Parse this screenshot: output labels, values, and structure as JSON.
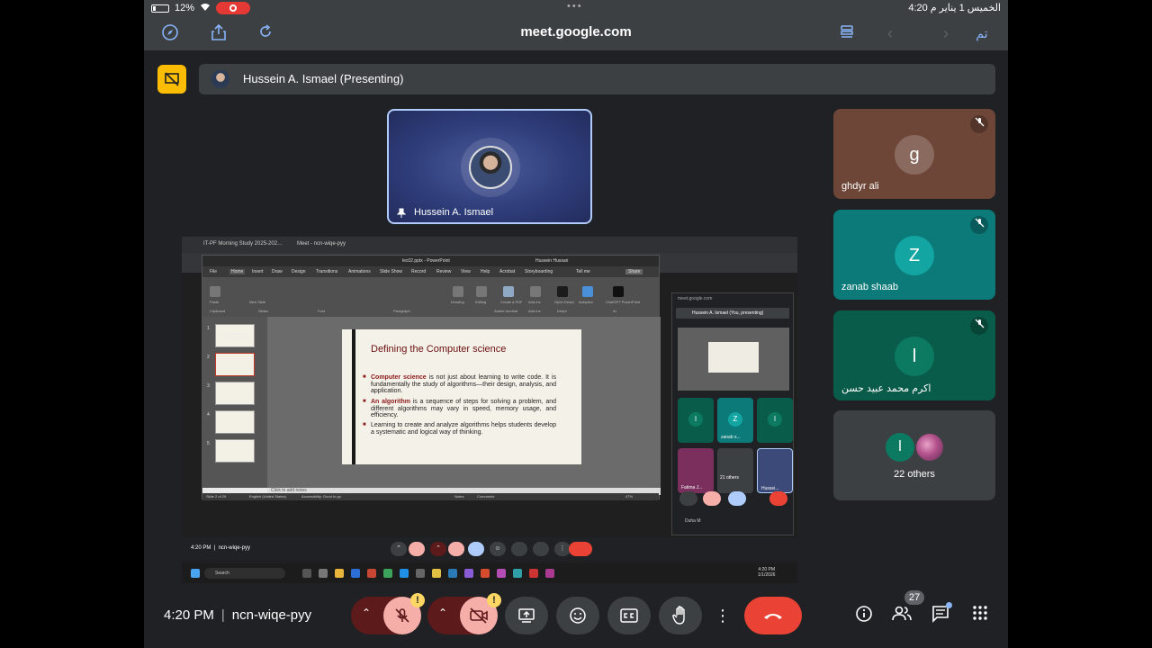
{
  "status_bar": {
    "battery": "12%",
    "dots": "•••",
    "datetime": "4:20  الخميس 1 يناير م"
  },
  "browser": {
    "url": "meet.google.com",
    "done_label": "تم"
  },
  "presentation": {
    "presenter_label": "Hussein A. Ismael (Presenting)",
    "presenter_tile_name": "Hussein A. Ismael"
  },
  "participants": [
    {
      "initial": "g",
      "name": "ghdyr ali"
    },
    {
      "initial": "Z",
      "name": "zanab shaab"
    },
    {
      "initial": "ا",
      "name": "اكرم محمد عبيد حسن"
    }
  ],
  "others": {
    "initial": "ا",
    "label": "22 others"
  },
  "shared_screen": {
    "tab1": "IT-PF Morning Study 2025-202…",
    "tab2": "Meet - ncn-wiqe-pyy",
    "ppt_title": "lec02.pptx  -  PowerPoint",
    "ppt_user": "Hussein Hussari",
    "ribbon_tabs": [
      "File",
      "Home",
      "Insert",
      "Draw",
      "Design",
      "Transitions",
      "Animations",
      "Slide Show",
      "Record",
      "Review",
      "View",
      "Help",
      "Acrobat",
      "Storyboarding",
      "Tell me"
    ],
    "ribbon_groups": [
      "Clipboard",
      "Slides",
      "Font",
      "Paragraph",
      "Adobe Acrobat",
      "Add-ins",
      "Deepl",
      "AI"
    ],
    "ribbon_buttons": [
      "Paste",
      "New Slide",
      "Drawing",
      "Editing",
      "Create a PDF",
      "Add-ins",
      "Open DeepL",
      "Autopilot",
      "ChatGPT PowerPoint"
    ],
    "share_button": "Share",
    "slide": {
      "title": "Defining the Computer science",
      "bullets": [
        {
          "key": "Computer science",
          "text": " is not just about learning to write code. It is fundamentally the study of algorithms—their design, analysis, and application."
        },
        {
          "key": "An algorithm",
          "text": " is a sequence of steps for solving a problem, and different algorithms may vary in speed, memory usage, and efficiency."
        },
        {
          "key": "",
          "text": "Learning to create and analyze algorithms helps students develop a systematic and logical way of thinking."
        }
      ]
    },
    "thumb_title": "PROGRAMMING FUNDAMENTALS I",
    "notes_placeholder": "Click to add notes",
    "status": {
      "slide": "Slide 2 of 29",
      "language": "English (United States)",
      "accessibility": "Accessibility: Good to go",
      "notes": "Notes",
      "comments": "Comments",
      "zoom": "47%"
    },
    "mini_meet": {
      "url": "meet.google.com",
      "header": "Hussein A. Ismael (You, presenting)",
      "tiles": [
        "ا",
        "zanab s...",
        "ا",
        "Fatima J...",
        "21 others",
        "Hussei..."
      ],
      "footer_name": "Duha M",
      "badge": "27"
    },
    "meet_bar": {
      "time": "4:20 PM",
      "code": "ncn-wiqe-pyy"
    },
    "taskbar": {
      "search": "Search",
      "time": "4:20 PM",
      "date": "1/1/2026"
    }
  },
  "controls": {
    "time": "4:20 PM",
    "meeting_code": "ncn-wiqe-pyy",
    "warn_symbol": "!",
    "people_count": "27"
  },
  "colors": {
    "leave": "#ea4335",
    "muted_bg": "#f6aea9",
    "presenter_border": "#aecbfa",
    "accent_blue": "#8ab4f8"
  }
}
